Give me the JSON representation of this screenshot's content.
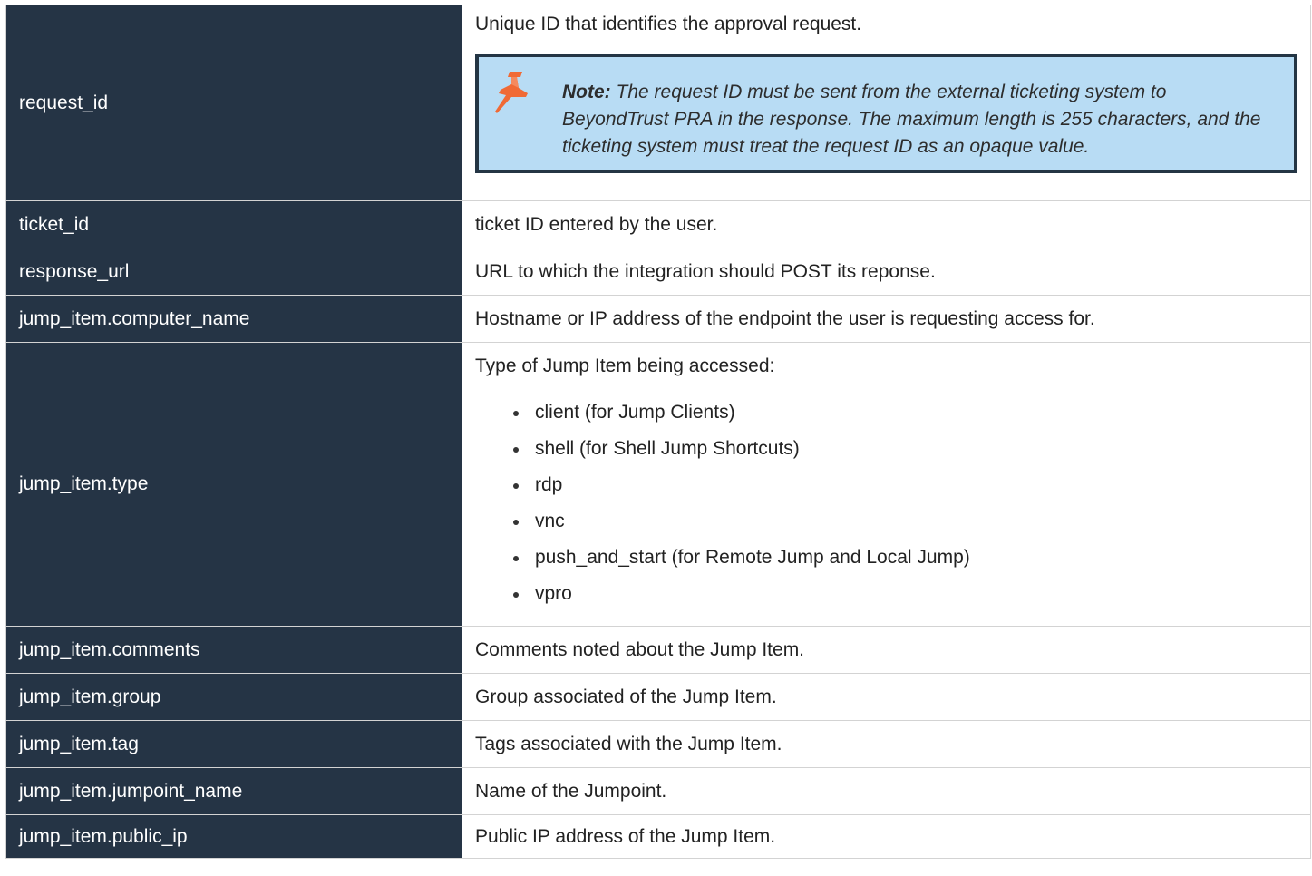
{
  "rows": [
    {
      "key": "request_id",
      "value": "Unique ID that identifies the approval request.",
      "note": {
        "label": "Note:",
        "text": " The request ID must be sent from the external ticketing system to BeyondTrust PRA in the response. The maximum length is 255 characters, and the ticketing system must treat the request ID as an opaque value.",
        "icon": "pushpin-icon",
        "icon_color": "#f06a35",
        "background": "#b8dcf4",
        "border": "#243544"
      }
    },
    {
      "key": "ticket_id",
      "value": "ticket ID entered by the user."
    },
    {
      "key": "response_url",
      "value": "URL to which the integration should POST its reponse."
    },
    {
      "key": "jump_item.computer_name",
      "value": "Hostname or IP address of the endpoint the user is requesting access for."
    },
    {
      "key": "jump_item.type",
      "value": "Type of Jump Item being accessed:",
      "list": [
        "client (for Jump Clients)",
        "shell (for Shell Jump Shortcuts)",
        "rdp",
        "vnc",
        "push_and_start (for Remote Jump and Local Jump)",
        "vpro"
      ]
    },
    {
      "key": "jump_item.comments",
      "value": "Comments noted about the Jump Item."
    },
    {
      "key": "jump_item.group",
      "value": "Group associated of the Jump Item."
    },
    {
      "key": "jump_item.tag",
      "value": "Tags associated with the Jump Item."
    },
    {
      "key": "jump_item.jumpoint_name",
      "value": "Name of the Jumpoint."
    },
    {
      "key": "jump_item.public_ip",
      "value": "Public IP address of the Jump Item."
    }
  ],
  "colors": {
    "key_background": "#253445",
    "key_text": "#ffffff",
    "border": "#d3d3d3"
  }
}
